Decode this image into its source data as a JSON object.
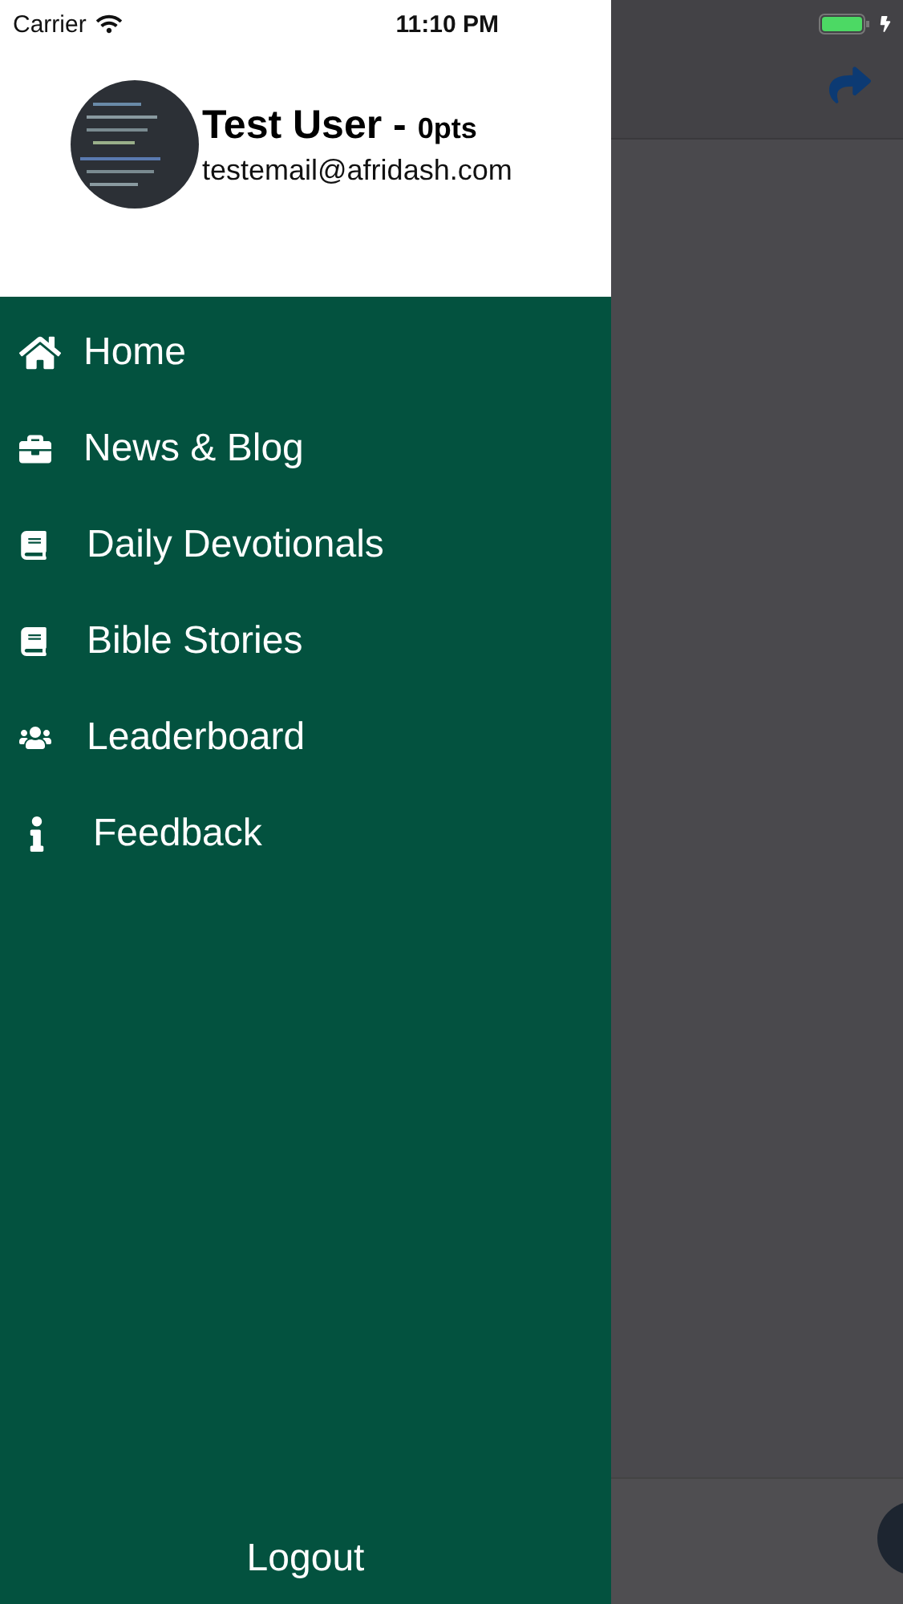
{
  "status_bar": {
    "carrier": "Carrier",
    "time": "11:10 PM"
  },
  "profile": {
    "name": "Test User - ",
    "points": "0pts",
    "email": "testemail@afridash.com"
  },
  "menu": [
    {
      "label": "Home"
    },
    {
      "label": "News & Blog"
    },
    {
      "label": "Daily Devotionals"
    },
    {
      "label": "Bible Stories"
    },
    {
      "label": "Leaderboard"
    },
    {
      "label": "Feedback"
    }
  ],
  "logout": "Logout"
}
